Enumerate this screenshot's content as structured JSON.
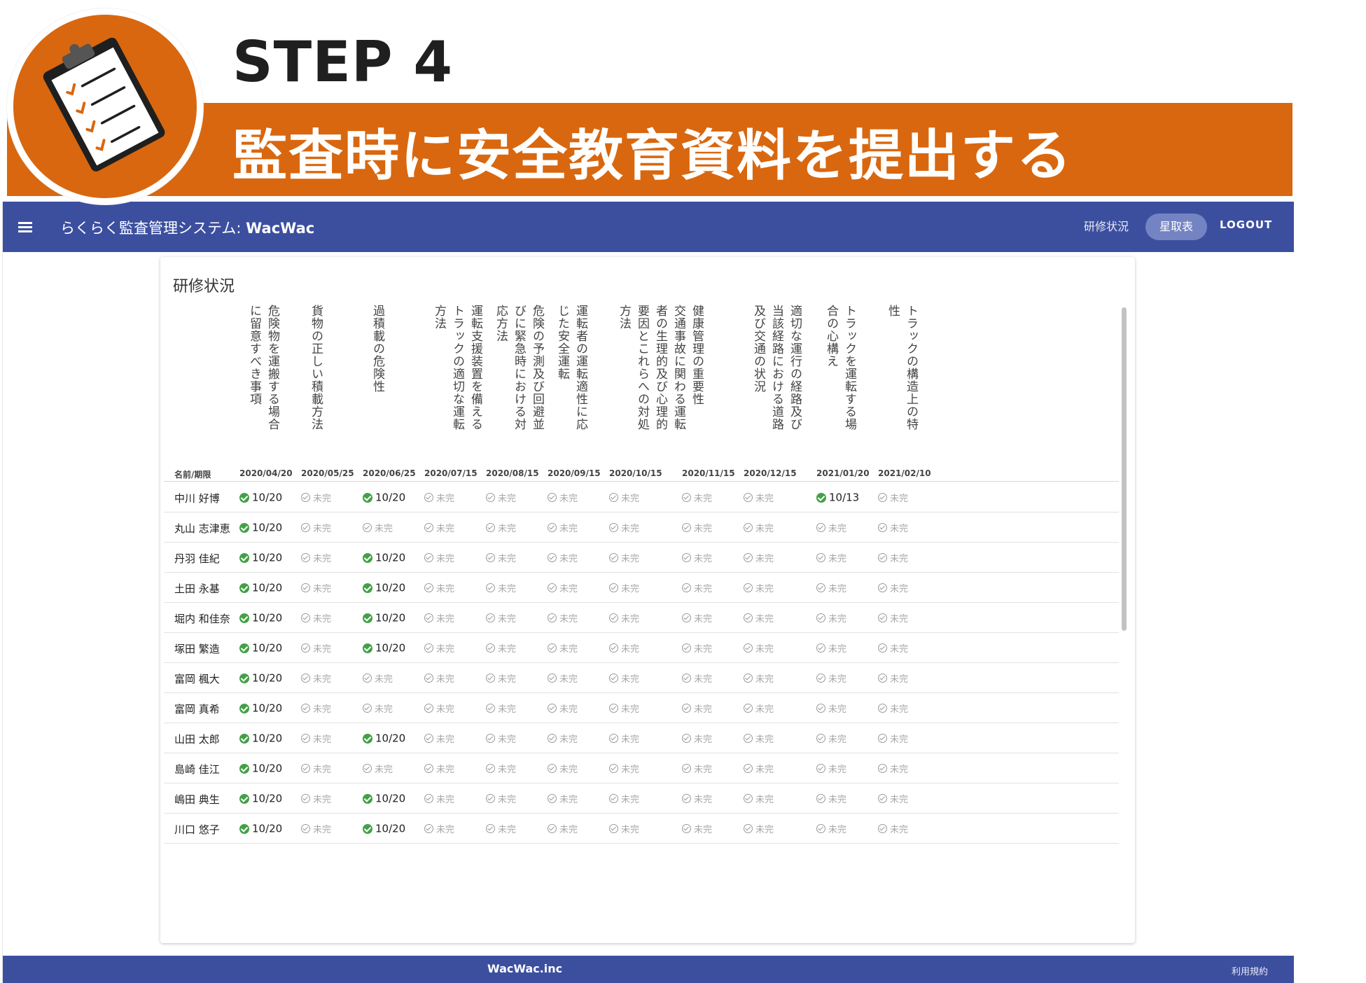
{
  "banner": {
    "step": "STEP 4",
    "subtitle": "監査時に安全教育資料を提出する",
    "icon": "clipboard-checklist-icon",
    "color": "#d9670f"
  },
  "appbar": {
    "title_prefix": "らくらく監査管理システム: ",
    "title_brand": "WacWac",
    "nav": [
      "研修状況",
      "星取表"
    ],
    "active": "星取表",
    "logout": "LOGOUT",
    "color": "#3c4f9f"
  },
  "card": {
    "title": "研修状況",
    "name_header": "名前/期限",
    "columns": [
      {
        "topic": "危険物を運搬する場合に留意すべき事項",
        "deadline": "2020/04/20"
      },
      {
        "topic": "貨物の正しい積載方法",
        "deadline": "2020/05/25"
      },
      {
        "topic": "過積載の危険性",
        "deadline": "2020/06/25"
      },
      {
        "topic": "運転支援装置を備えるトラックの適切な運転方法",
        "deadline": "2020/07/15"
      },
      {
        "topic": "危険の予測及び回避並びに緊急時における対応方法",
        "deadline": "2020/08/15"
      },
      {
        "topic": "運転者の運転適性に応じた安全運転",
        "deadline": "2020/09/15"
      },
      {
        "topic": "交通事故に関わる運転者の生理的及び心理的要因とこれらへの対処方法",
        "deadline": "2020/10/15"
      },
      {
        "topic": "健康管理の重要性",
        "deadline": "2020/11/15"
      },
      {
        "topic": "適切な運行の経路及び当該経路における道路及び交通の状況",
        "deadline": "2020/12/15"
      },
      {
        "topic": "トラックを運転する場合の心構え",
        "deadline": "2021/01/20"
      },
      {
        "topic": "トラックの構造上の特性",
        "deadline": "2021/02/10"
      }
    ],
    "rows": [
      {
        "name": "中川 好博",
        "cells": [
          "10/20",
          "未完",
          "10/20",
          "未完",
          "未完",
          "未完",
          "未完",
          "未完",
          "未完",
          "10/13",
          "未完"
        ]
      },
      {
        "name": "丸山 志津恵",
        "cells": [
          "10/20",
          "未完",
          "未完",
          "未完",
          "未完",
          "未完",
          "未完",
          "未完",
          "未完",
          "未完",
          "未完"
        ]
      },
      {
        "name": "丹羽 佳紀",
        "cells": [
          "10/20",
          "未完",
          "10/20",
          "未完",
          "未完",
          "未完",
          "未完",
          "未完",
          "未完",
          "未完",
          "未完"
        ]
      },
      {
        "name": "土田 永基",
        "cells": [
          "10/20",
          "未完",
          "10/20",
          "未完",
          "未完",
          "未完",
          "未完",
          "未完",
          "未完",
          "未完",
          "未完"
        ]
      },
      {
        "name": "堀内 和佳奈",
        "cells": [
          "10/20",
          "未完",
          "10/20",
          "未完",
          "未完",
          "未完",
          "未完",
          "未完",
          "未完",
          "未完",
          "未完"
        ]
      },
      {
        "name": "塚田 繁造",
        "cells": [
          "10/20",
          "未完",
          "10/20",
          "未完",
          "未完",
          "未完",
          "未完",
          "未完",
          "未完",
          "未完",
          "未完"
        ]
      },
      {
        "name": "富岡 楓大",
        "cells": [
          "10/20",
          "未完",
          "未完",
          "未完",
          "未完",
          "未完",
          "未完",
          "未完",
          "未完",
          "未完",
          "未完"
        ]
      },
      {
        "name": "富岡 真希",
        "cells": [
          "10/20",
          "未完",
          "未完",
          "未完",
          "未完",
          "未完",
          "未完",
          "未完",
          "未完",
          "未完",
          "未完"
        ]
      },
      {
        "name": "山田 太郎",
        "cells": [
          "10/20",
          "未完",
          "10/20",
          "未完",
          "未完",
          "未完",
          "未完",
          "未完",
          "未完",
          "未完",
          "未完"
        ]
      },
      {
        "name": "島崎 佳江",
        "cells": [
          "10/20",
          "未完",
          "未完",
          "未完",
          "未完",
          "未完",
          "未完",
          "未完",
          "未完",
          "未完",
          "未完"
        ]
      },
      {
        "name": "嶋田 典生",
        "cells": [
          "10/20",
          "未完",
          "10/20",
          "未完",
          "未完",
          "未完",
          "未完",
          "未完",
          "未完",
          "未完",
          "未完"
        ]
      },
      {
        "name": "川口 悠子",
        "cells": [
          "10/20",
          "未完",
          "10/20",
          "未完",
          "未完",
          "未完",
          "未完",
          "未完",
          "未完",
          "未完",
          "未完"
        ]
      }
    ],
    "done_color": "#43a047",
    "todo_label": "未完"
  },
  "footer": {
    "company": "WacWac.inc",
    "terms": "利用規約"
  }
}
